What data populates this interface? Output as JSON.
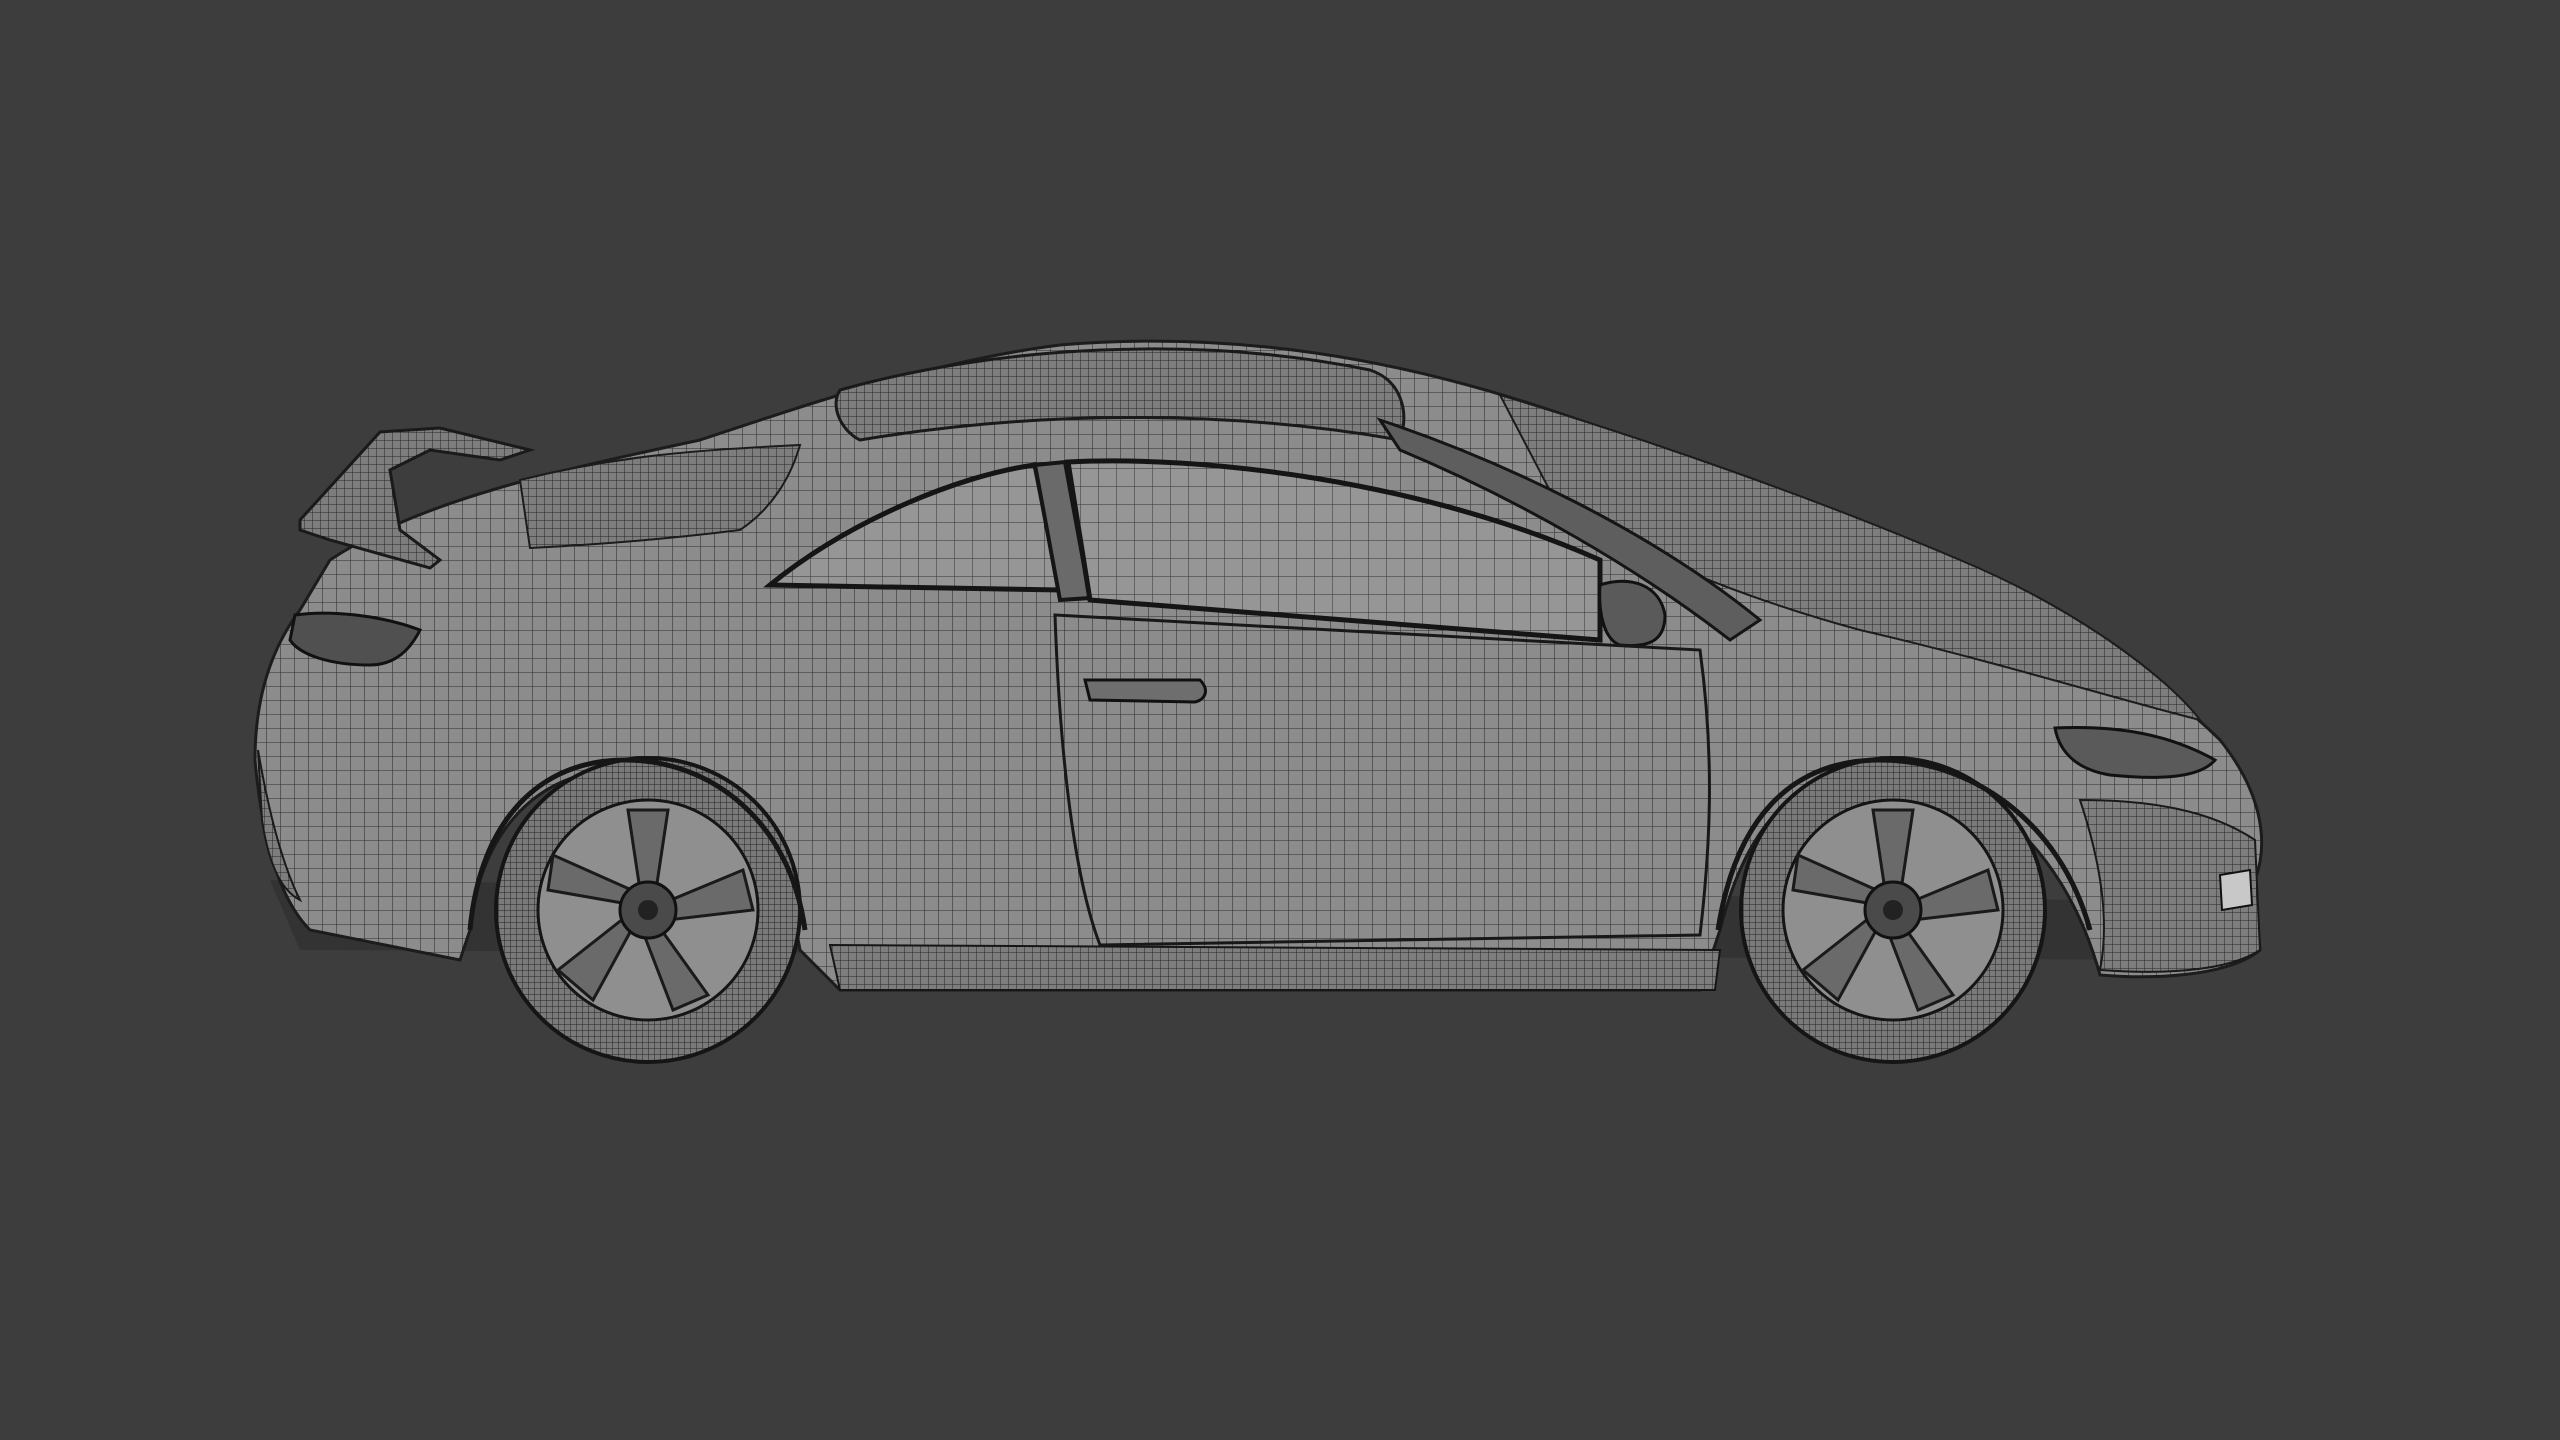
{
  "viewport": {
    "background_color": "#3d3d3d",
    "display_mode": "wireframe-overlay",
    "view": "side-orthographic"
  },
  "model": {
    "object": "car-coupe",
    "surface_color": "#8a8a8a",
    "wire_color": "#2b2b2b",
    "parts": [
      "body",
      "rear-spoiler",
      "sunroof",
      "side-window",
      "door",
      "door-handle",
      "side-mirror",
      "headlight",
      "taillight",
      "front-wheel",
      "rear-wheel"
    ]
  }
}
